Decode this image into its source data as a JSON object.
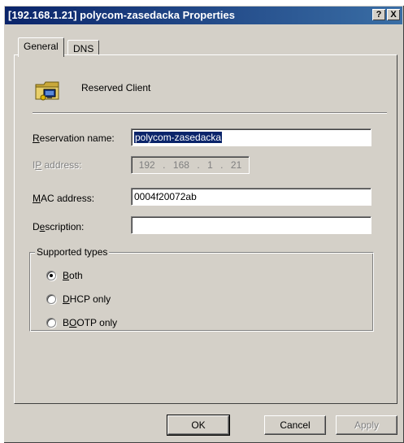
{
  "window": {
    "title": "[192.168.1.21] polycom-zasedacka Properties",
    "help_label": "?",
    "close_label": "X"
  },
  "tabs": [
    {
      "label": "General",
      "active": true
    },
    {
      "label": "DNS",
      "active": false
    }
  ],
  "header": {
    "icon": "reserved-client-icon",
    "label": "Reserved Client"
  },
  "form": {
    "reservation_name": {
      "label": "Reservation name:",
      "mnemonic": "R",
      "value": "polycom-zasedacka"
    },
    "ip_address": {
      "label": "IP address:",
      "mnemonic": "P",
      "octets": [
        "192",
        "168",
        "1",
        "21"
      ],
      "enabled": false
    },
    "mac_address": {
      "label": "MAC address:",
      "mnemonic": "M",
      "value": "0004f20072ab"
    },
    "description": {
      "label": "Description:",
      "mnemonic": "e",
      "value": ""
    }
  },
  "supported_types": {
    "legend": "Supported types",
    "options": [
      {
        "label": "Both",
        "mnemonic": "B",
        "checked": true
      },
      {
        "label": "DHCP only",
        "mnemonic": "D",
        "checked": false
      },
      {
        "label": "BOOTP only",
        "mnemonic": "O",
        "checked": false
      }
    ]
  },
  "buttons": {
    "ok": "OK",
    "cancel": "Cancel",
    "apply": "Apply"
  },
  "colors": {
    "titlebar": "#0a246a",
    "face": "#d4d0c8",
    "selection": "#0a246a"
  }
}
